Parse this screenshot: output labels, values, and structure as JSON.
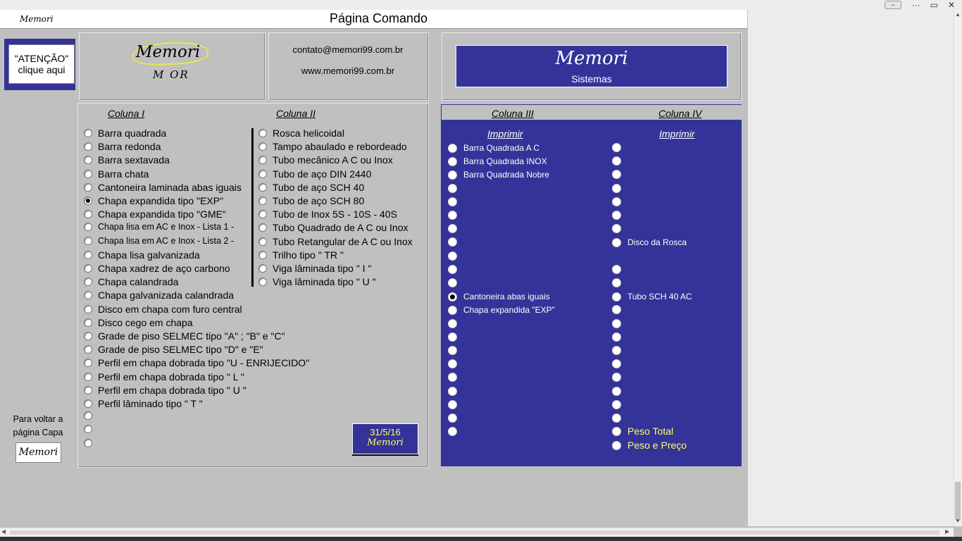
{
  "window": {
    "doc_name": "Memori",
    "page_title": "Página Comando",
    "controls": [
      "···",
      "▭",
      "✕"
    ]
  },
  "atencao": {
    "line1": "\"ATENÇÃO\"",
    "line2": "clique aqui"
  },
  "logo": {
    "title": "Memori",
    "sub": "M OR"
  },
  "contact": {
    "email": "contato@memori99.com.br",
    "web": "www.memori99.com.br"
  },
  "brand": {
    "title": "Memori",
    "sub": "Sistemas"
  },
  "colunas": {
    "c1": "Coluna I",
    "c2": "Coluna II",
    "c3": "Coluna III",
    "c4": "Coluna IV"
  },
  "col1": [
    {
      "label": "Barra quadrada",
      "on": false,
      "small": false
    },
    {
      "label": "Barra redonda",
      "on": false,
      "small": false
    },
    {
      "label": "Barra sextavada",
      "on": false,
      "small": false
    },
    {
      "label": "Barra chata",
      "on": false,
      "small": false
    },
    {
      "label": "Cantoneira laminada abas iguais",
      "on": false,
      "small": false
    },
    {
      "label": "Chapa expandida tipo \"EXP\"",
      "on": true,
      "small": false
    },
    {
      "label": "Chapa expandida tipo \"GME\"",
      "on": false,
      "small": false
    },
    {
      "label": "Chapa lisa em AC e Inox - Lista 1 -",
      "on": false,
      "small": true
    },
    {
      "label": "Chapa lisa em AC e Inox - Lista 2 -",
      "on": false,
      "small": true
    },
    {
      "label": "Chapa lisa galvanizada",
      "on": false,
      "small": false
    },
    {
      "label": "Chapa xadrez de aço carbono",
      "on": false,
      "small": false
    },
    {
      "label": "Chapa calandrada",
      "on": false,
      "small": false
    },
    {
      "label": "Chapa galvanizada calandrada",
      "on": false,
      "small": false
    },
    {
      "label": "Disco em chapa com furo central",
      "on": false,
      "small": false
    },
    {
      "label": "Disco cego em chapa",
      "on": false,
      "small": false
    },
    {
      "label": "Grade de piso SELMEC tipo \"A\" ; \"B\" e \"C\"",
      "on": false,
      "small": false
    },
    {
      "label": "Grade de piso SELMEC tipo \"D\" e \"E\"",
      "on": false,
      "small": false
    },
    {
      "label": "Perfil em chapa dobrada tipo \"U - ENRIJECIDO\"",
      "on": false,
      "small": false
    },
    {
      "label": "Perfil em chapa dobrada tipo \" L \"",
      "on": false,
      "small": false
    },
    {
      "label": "Perfil em chapa dobrada tipo \" U \"",
      "on": false,
      "small": false
    },
    {
      "label": "Perfil lâminado tipo \" T \"",
      "on": false,
      "small": false
    },
    {
      "label": "",
      "on": false,
      "small": false
    },
    {
      "label": "",
      "on": false,
      "small": false
    },
    {
      "label": "",
      "on": false,
      "small": false
    }
  ],
  "col2": [
    {
      "label": "Rosca helicoidal",
      "on": false
    },
    {
      "label": "Tampo abaulado e rebordeado",
      "on": false
    },
    {
      "label": "Tubo mecânico A C ou Inox",
      "on": false
    },
    {
      "label": "Tubo de aço DIN 2440",
      "on": false
    },
    {
      "label": "Tubo de aço SCH 40",
      "on": false
    },
    {
      "label": "Tubo de aço SCH 80",
      "on": false
    },
    {
      "label": "Tubo de Inox 5S - 10S - 40S",
      "on": false
    },
    {
      "label": "Tubo Quadrado de A C ou Inox",
      "on": false
    },
    {
      "label": "Tubo Retangular de A C ou Inox",
      "on": false
    },
    {
      "label": "Trilho tipo \" TR \"",
      "on": false
    },
    {
      "label": "Viga  lâminada tipo \" I \"",
      "on": false
    },
    {
      "label": "Viga lâminada tipo  \" U \"",
      "on": false
    }
  ],
  "imprimir": "Imprimir",
  "col3": [
    {
      "label": "Barra Quadrada A C",
      "on": false
    },
    {
      "label": "Barra Quadrada INOX",
      "on": false
    },
    {
      "label": "Barra Quadrada Nobre",
      "on": false
    },
    {
      "label": "",
      "on": false
    },
    {
      "label": "",
      "on": false
    },
    {
      "label": "",
      "on": false
    },
    {
      "label": "",
      "on": false
    },
    {
      "label": "",
      "on": false
    },
    {
      "label": "",
      "on": false
    },
    {
      "label": "",
      "on": false
    },
    {
      "label": "",
      "on": false
    },
    {
      "label": "Cantoneira abas iguais",
      "on": true
    },
    {
      "label": "Chapa expandida \"EXP\"",
      "on": false
    },
    {
      "label": "",
      "on": false
    },
    {
      "label": "",
      "on": false
    },
    {
      "label": "",
      "on": false
    },
    {
      "label": "",
      "on": false
    },
    {
      "label": "",
      "on": false
    },
    {
      "label": "",
      "on": false
    },
    {
      "label": "",
      "on": false
    },
    {
      "label": "",
      "on": false
    },
    {
      "label": "",
      "on": false
    }
  ],
  "col4": [
    {
      "label": "",
      "slot": 0
    },
    {
      "label": "",
      "slot": 1
    },
    {
      "label": "",
      "slot": 2
    },
    {
      "label": "",
      "slot": 3
    },
    {
      "label": "",
      "slot": 4
    },
    {
      "label": "",
      "slot": 5
    },
    {
      "label": "",
      "slot": 6
    },
    {
      "label": "Disco da Rosca",
      "slot": 7
    },
    {
      "label": "",
      "slot": 9
    },
    {
      "label": "",
      "slot": 10
    },
    {
      "label": "Tubo SCH 40 AC",
      "slot": 11
    },
    {
      "label": "",
      "slot": 12
    },
    {
      "label": "",
      "slot": 13
    },
    {
      "label": "",
      "slot": 14
    },
    {
      "label": "",
      "slot": 15
    },
    {
      "label": "",
      "slot": 16
    },
    {
      "label": "",
      "slot": 17
    },
    {
      "label": "",
      "slot": 18
    },
    {
      "label": "",
      "slot": 19
    },
    {
      "label": "",
      "slot": 20
    }
  ],
  "peso_total": "Peso Total",
  "peso_preco": "Peso e Preço",
  "date": {
    "value": "31/5/16",
    "brand": "Memori"
  },
  "back": {
    "line1": "Para voltar a",
    "line2": "página Capa",
    "button": "Memori"
  }
}
